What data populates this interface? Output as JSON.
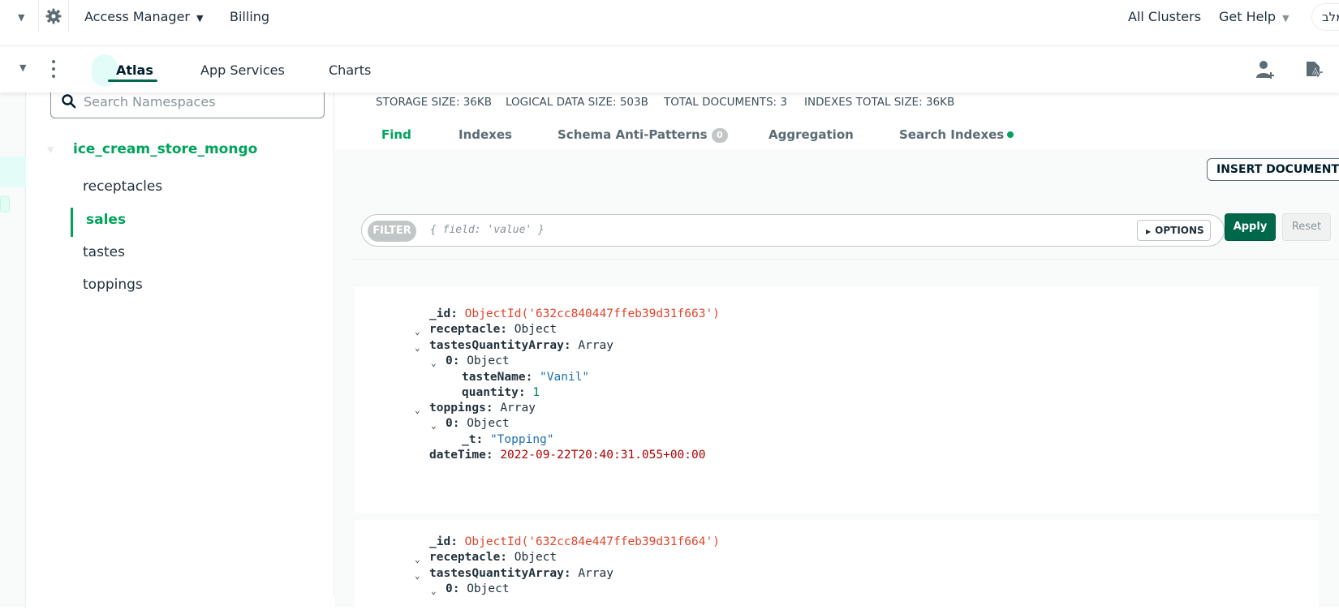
{
  "topbar": {
    "access_manager": "Access Manager",
    "billing": "Billing",
    "all_clusters": "All Clusters",
    "get_help": "Get Help",
    "lang": "מלב"
  },
  "nav": {
    "tabs": [
      "Atlas",
      "App Services",
      "Charts"
    ],
    "active_tab": "Atlas"
  },
  "sidebar": {
    "search_placeholder": "Search Namespaces",
    "database": "ice_cream_store_mongo",
    "collections": [
      "receptacles",
      "sales",
      "tastes",
      "toppings"
    ],
    "active_collection": "sales"
  },
  "stats": {
    "storage": "STORAGE SIZE: 36KB",
    "logical": "LOGICAL DATA SIZE: 503B",
    "total_docs": "TOTAL DOCUMENTS: 3",
    "indexes": "INDEXES TOTAL SIZE: 36KB"
  },
  "subtabs": {
    "find": "Find",
    "indexes": "Indexes",
    "schema": "Schema Anti-Patterns",
    "schema_count": "0",
    "aggregation": "Aggregation",
    "search_indexes": "Search Indexes"
  },
  "actions": {
    "insert": "INSERT DOCUMENT",
    "filter": "FILTER",
    "filter_placeholder": "{ field: 'value' }",
    "options": "OPTIONS",
    "apply": "Apply",
    "reset": "Reset"
  },
  "documents": [
    {
      "id": "ObjectId('632cc840447ffeb39d31f663')",
      "receptacle": "Object",
      "tastes_array": "Array",
      "taste_item": "Object",
      "taste_name": "\"Vanil\"",
      "quantity": "1",
      "toppings": "Array",
      "topping_item": "Object",
      "topping_t": "\"Topping\"",
      "date_time": "2022-09-22T20:40:31.055+00:00"
    },
    {
      "id": "ObjectId('632cc84e447ffeb39d31f664')",
      "receptacle": "Object",
      "tastes_array": "Array",
      "taste_item": "Object"
    }
  ],
  "labels": {
    "id": "_id:",
    "receptacle": "receptacle:",
    "tastes": "tastesQuantityArray:",
    "zero": "0:",
    "taste_name": "tasteName:",
    "quantity": "quantity:",
    "toppings": "toppings:",
    "t": "_t:",
    "date_time": "dateTime:"
  }
}
